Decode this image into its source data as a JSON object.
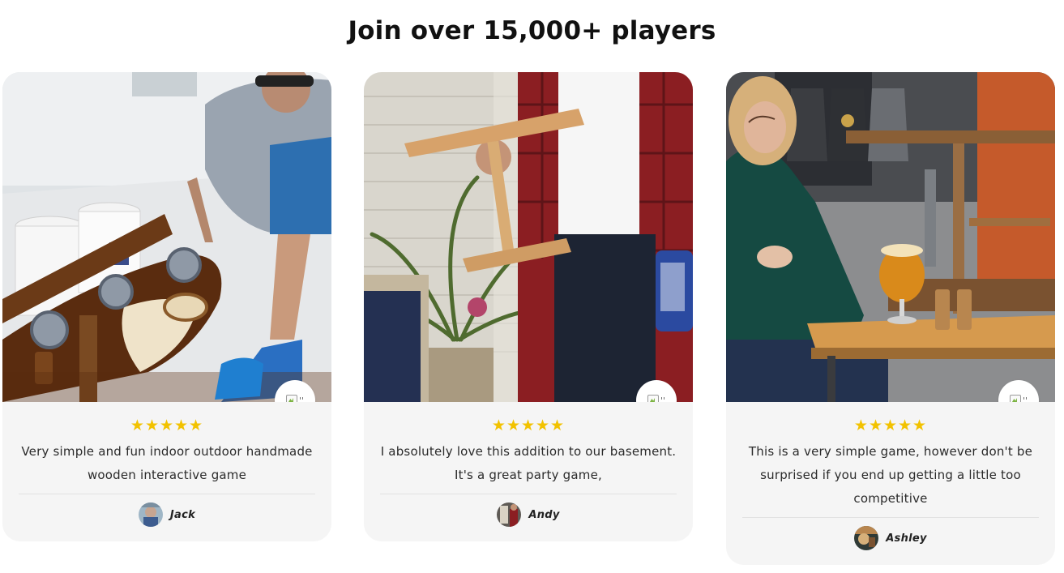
{
  "section": {
    "title": "Join over 15,000+ players"
  },
  "reviews": [
    {
      "rating_stars": "★★★★★",
      "text": "Very simple and fun indoor outdoor handmade wooden interactive game",
      "author": "Jack",
      "badge_text": "''",
      "photo_icon": "photo-boat-game",
      "avatar_icon": "avatar-jack"
    },
    {
      "rating_stars": "★★★★★",
      "text": "I absolutely love this addition to our basement. It's a great party game,",
      "author": "Andy",
      "badge_text": "''",
      "photo_icon": "photo-porch-game",
      "avatar_icon": "avatar-andy"
    },
    {
      "rating_stars": "★★★★★",
      "text": "This is a very simple game, however don't be surprised if you end up getting a little too competitive",
      "author": "Ashley",
      "badge_text": "''",
      "photo_icon": "photo-bar-game",
      "avatar_icon": "avatar-ashley"
    }
  ],
  "colors": {
    "star": "#f2c200",
    "card_bg": "#f5f5f5",
    "heading": "#111111"
  }
}
